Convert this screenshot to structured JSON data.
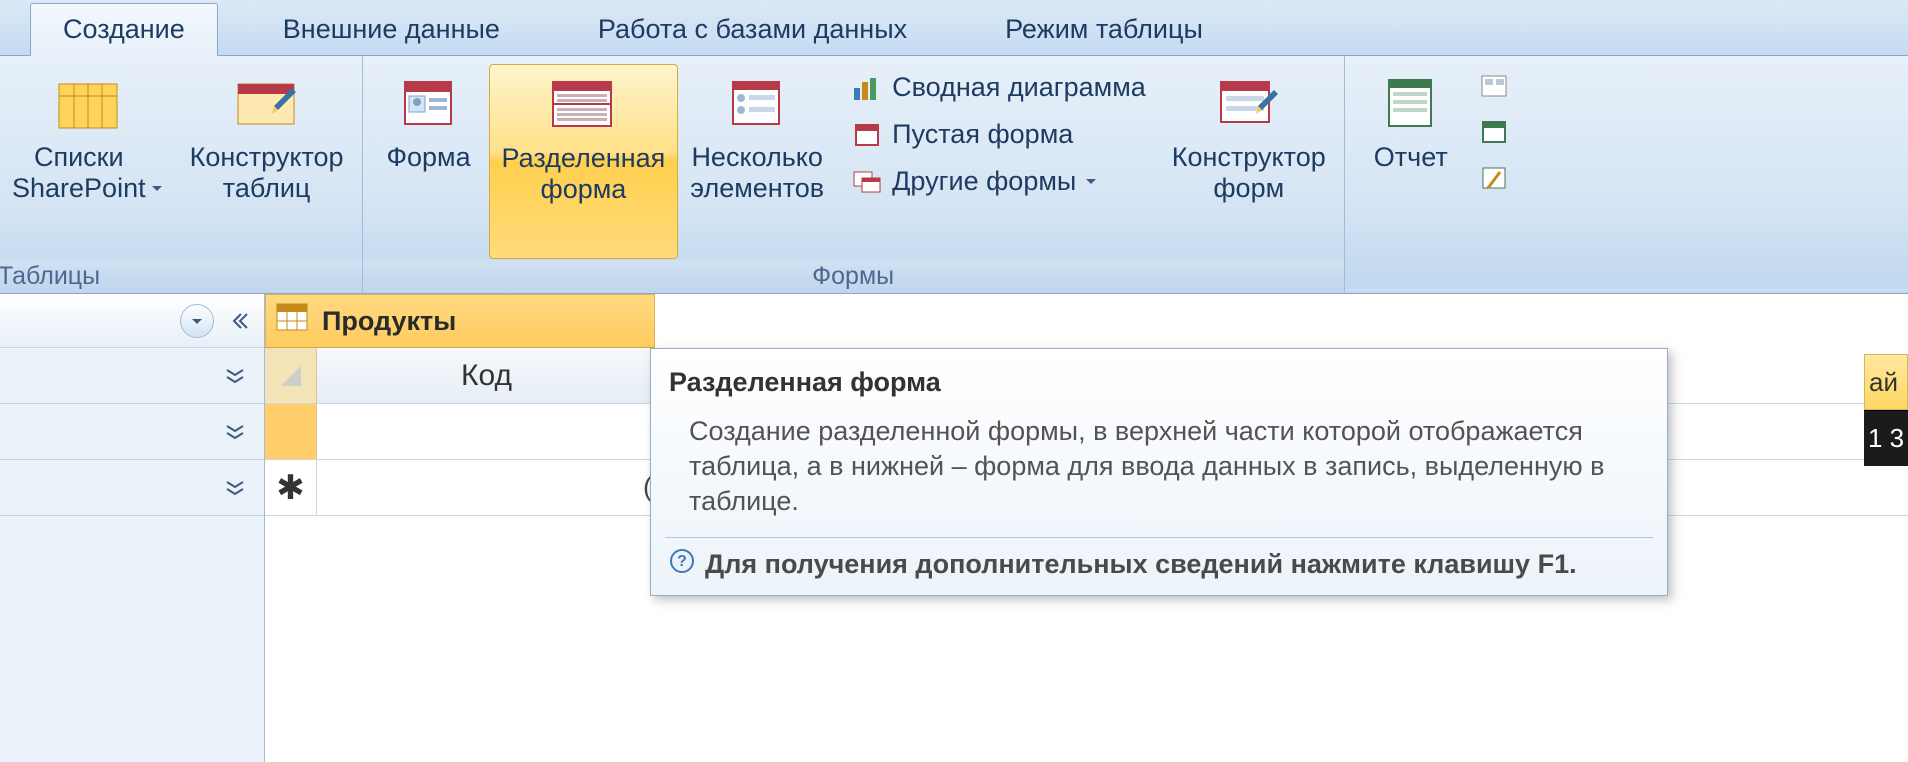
{
  "tabs": {
    "create": "Создание",
    "external": "Внешние данные",
    "database": "Работа с базами данных",
    "datasheet": "Режим таблицы"
  },
  "ribbon": {
    "group_tables_label": "Таблицы",
    "group_forms_label": "Формы",
    "tables": {
      "sharepoint": "Списки\nSharePoint",
      "design": "Конструктор\nтаблиц"
    },
    "forms": {
      "form": "Форма",
      "split": "Разделенная\nформа",
      "multi": "Несколько\nэлементов",
      "pivot": "Сводная диаграмма",
      "blank": "Пустая форма",
      "more": "Другие формы",
      "design": "Конструктор\nформ"
    },
    "reports": {
      "report": "Отчет"
    }
  },
  "doc": {
    "tab_title": "Продукты",
    "col1": "Код",
    "new_row_placeholder": "("
  },
  "tooltip": {
    "title": "Разделенная форма",
    "body": "Создание разделенной формы, в верхней части которой отображается таблица, а в нижней – форма для ввода данных в запись, выделенную в таблице.",
    "help": "Для получения дополнительных сведений нажмите клавишу F1."
  },
  "right": {
    "a": "ай",
    "b": "1 3"
  }
}
